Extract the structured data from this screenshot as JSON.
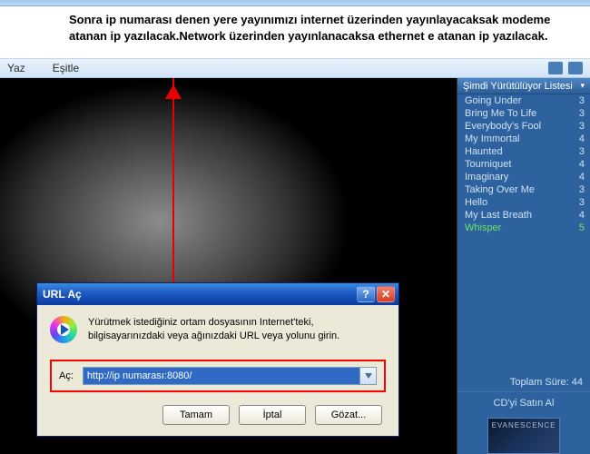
{
  "instruction": "Sonra ip numarası denen yere yayınımızı internet üzerinden yayınlayacaksak modeme atanan ip yazılacak.Network üzerinden yayınlanacaksa ethernet e atanan ip yazılacak.",
  "toolbar": {
    "item1": "Yaz",
    "item2": "Eşitle"
  },
  "sidebar": {
    "header": "Şimdi Yürütülüyor Listesi",
    "items": [
      {
        "label": "Going Under",
        "dur": "3"
      },
      {
        "label": "Bring Me To Life",
        "dur": "3"
      },
      {
        "label": "Everybody's Fool",
        "dur": "3"
      },
      {
        "label": "My Immortal",
        "dur": "4"
      },
      {
        "label": "Haunted",
        "dur": "3"
      },
      {
        "label": "Tourniquet",
        "dur": "4"
      },
      {
        "label": "Imaginary",
        "dur": "4"
      },
      {
        "label": "Taking Over Me",
        "dur": "3"
      },
      {
        "label": "Hello",
        "dur": "3"
      },
      {
        "label": "My Last Breath",
        "dur": "4"
      },
      {
        "label": "Whisper",
        "dur": "5"
      }
    ],
    "total": "Toplam Süre: 44",
    "buy": "CD'yi Satın Al",
    "album": "EVANESCENCE"
  },
  "dialog": {
    "title": "URL Aç",
    "help": "?",
    "close": "✕",
    "text": "Yürütmek istediğiniz ortam dosyasının Internet'teki, bilgisayarınızdaki veya ağınızdaki URL veya yolunu girin.",
    "label": "Aç:",
    "value": "http://ip numarası:8080/",
    "ok": "Tamam",
    "cancel": "İptal",
    "browse": "Gözat..."
  }
}
